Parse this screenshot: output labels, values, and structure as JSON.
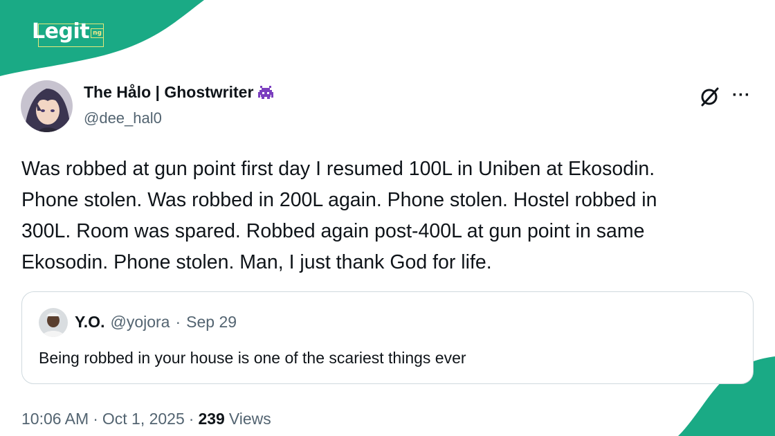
{
  "brand": {
    "logo_text": "Legit",
    "logo_suffix": "ng",
    "color": "#1aaa85"
  },
  "tweet": {
    "author_name": "The Hålo | Ghostwriter",
    "author_handle": "@dee_hal0",
    "badge_icon": "space-invader-icon",
    "text": "Was robbed at gun point first day I resumed 100L in Uniben at Ekosodin.\nPhone stolen. Was robbed in 200L again. Phone stolen. Hostel robbed in\n300L. Room was spared. Robbed again post-400L at gun point in same\nEkosodin. Phone stolen. Man, I just thank God for life.",
    "time": "10:06 AM",
    "date": "Oct 1, 2025",
    "views_count": "239",
    "views_label": "Views",
    "separator": "·",
    "more_label": "···"
  },
  "quote": {
    "author_name": "Y.O.",
    "author_handle": "@yojora",
    "date": "Sep 29",
    "separator": "·",
    "text": "Being robbed in your house is one of the scariest things ever"
  }
}
